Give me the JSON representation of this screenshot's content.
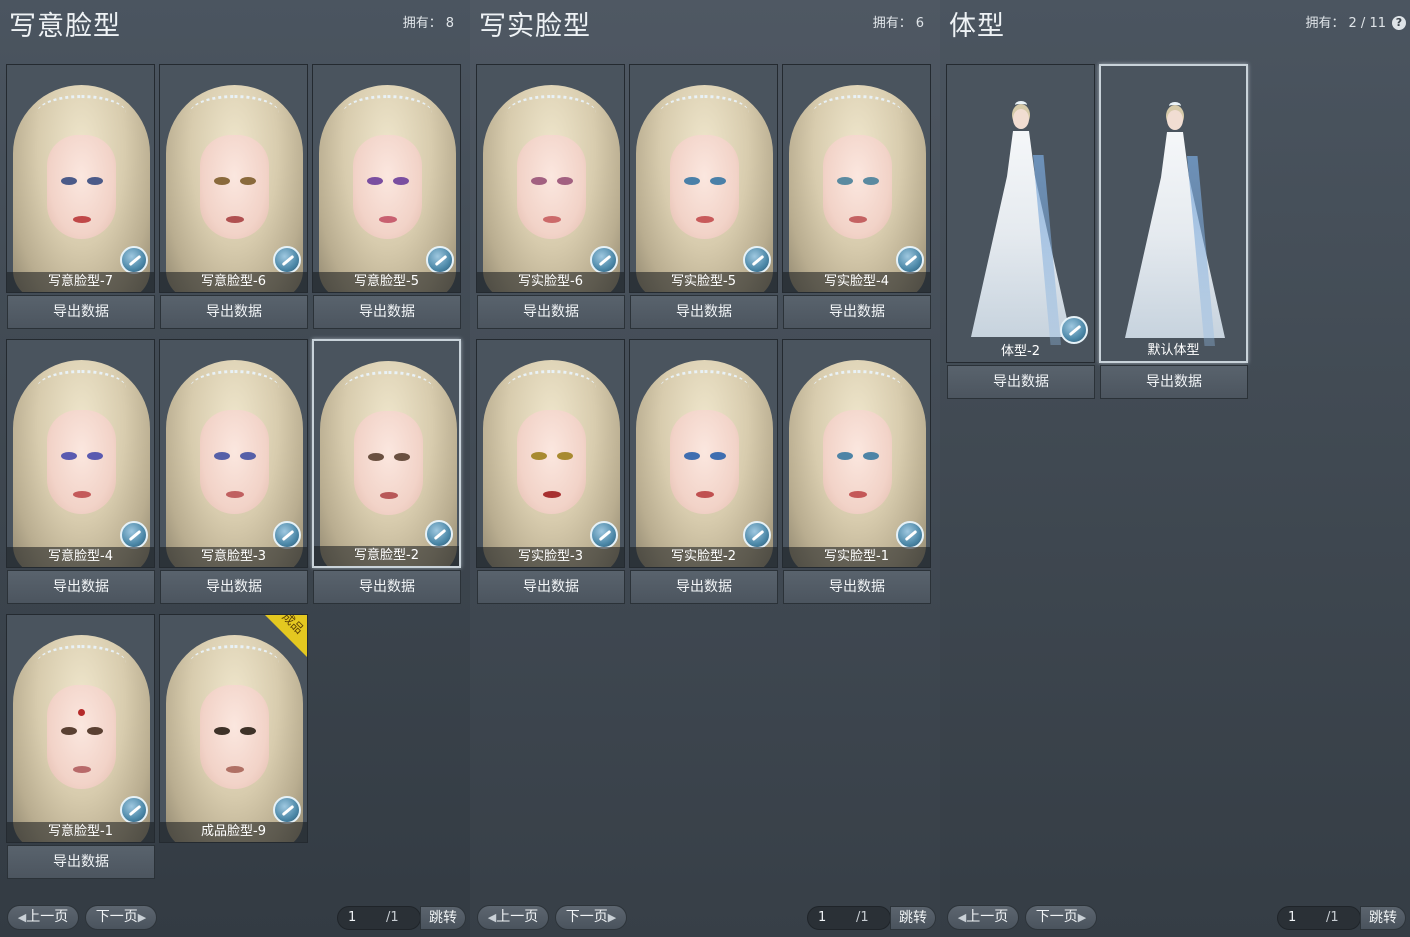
{
  "panels": [
    {
      "title": "写意脸型",
      "owned_label": "拥有：",
      "owned_value": "8",
      "cards": [
        {
          "label": "写意脸型-7"
        },
        {
          "label": "写意脸型-6"
        },
        {
          "label": "写意脸型-5"
        },
        {
          "label": "写意脸型-4"
        },
        {
          "label": "写意脸型-3"
        },
        {
          "label": "写意脸型-2"
        },
        {
          "label": "写意脸型-1"
        },
        {
          "label": "成品脸型-9",
          "badge": "成品"
        }
      ],
      "export_label": "导出数据"
    },
    {
      "title": "写实脸型",
      "owned_label": "拥有：",
      "owned_value": "6",
      "cards": [
        {
          "label": "写实脸型-6"
        },
        {
          "label": "写实脸型-5"
        },
        {
          "label": "写实脸型-4"
        },
        {
          "label": "写实脸型-3"
        },
        {
          "label": "写实脸型-2"
        },
        {
          "label": "写实脸型-1"
        }
      ],
      "export_label": "导出数据"
    },
    {
      "title": "体型",
      "owned_label": "拥有：",
      "owned_value": "2 / 11",
      "help_icon": "?",
      "cards": [
        {
          "label": "体型-2"
        },
        {
          "label": "默认体型"
        }
      ],
      "export_label": "导出数据"
    }
  ],
  "pager": {
    "prev_label": "上一页",
    "next_label": "下一页",
    "page_value": "1",
    "page_total": "/1",
    "jump_label": "跳转"
  },
  "icons": {
    "edit": "brush-icon",
    "prev": "chevron-left-icon",
    "next": "chevron-right-icon"
  },
  "colors": {
    "badge": "#e4c820",
    "panel_bg": "#434c56",
    "button_bg": "#535c66"
  }
}
